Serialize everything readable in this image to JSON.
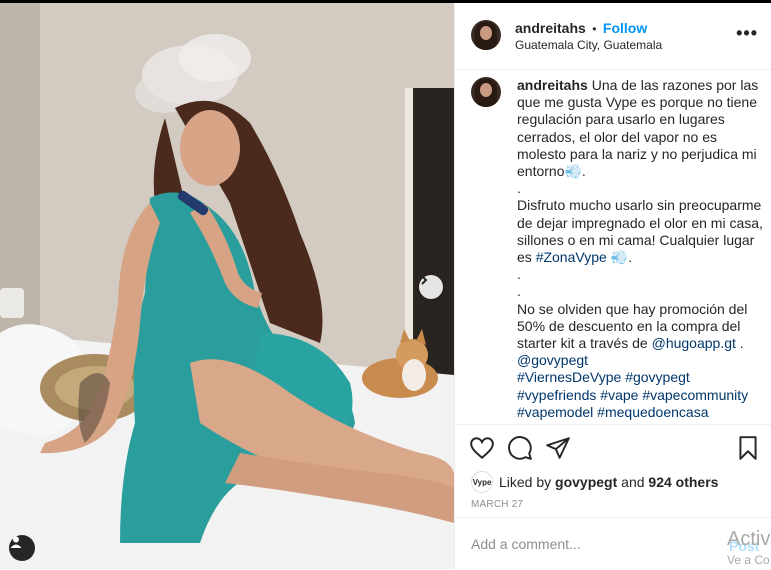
{
  "post": {
    "username": "andreitahs",
    "follow_label": "Follow",
    "bullet": "•",
    "location": "Guatemala City, Guatemala",
    "more_label": "•••"
  },
  "caption": {
    "username": "andreitahs",
    "p1": "Una de las razones por las que me gusta Vype es porque no tiene regulación para usarlo en lugares cerrados, el olor del vapor no es molesto para la nariz y no perjudica mi entorno",
    "emoji1": "💨",
    "dot1": ".",
    "p2": "Disfruto mucho usarlo sin preocuparme de dejar impregnado el olor en mi casa, sillones o en mi cama! Cualquier lugar es",
    "tag_zona": "#ZonaVype",
    "emoji2": "💨",
    "dot2": ".",
    "dot3": ".",
    "p3": "No se olviden que hay promoción del 50% de descuento en la compra del starter kit a través de",
    "mention_hugo": "@hugoapp.gt",
    "p3_end": ".",
    "mention_govy": "@govypegt",
    "tags": [
      "#ViernesDeVype",
      "#govypegt",
      "#vypefriends",
      "#vape",
      "#vapecommunity",
      "#vapemodel",
      "#mequedoencasa"
    ]
  },
  "actions": {
    "like_icon": "heart-icon",
    "comment_icon": "comment-icon",
    "share_icon": "paper-plane-icon",
    "save_icon": "bookmark-icon"
  },
  "likes": {
    "avatar_text": "Vype",
    "prefix": "Liked by",
    "by_user": "govypegt",
    "and": "and",
    "count": "924 others"
  },
  "date": "MARCH 27",
  "comment": {
    "placeholder": "Add a comment...",
    "post_label": "Post"
  },
  "overlay": {
    "activate_line1": "Activ",
    "activate_line2": "Ve a Co"
  }
}
